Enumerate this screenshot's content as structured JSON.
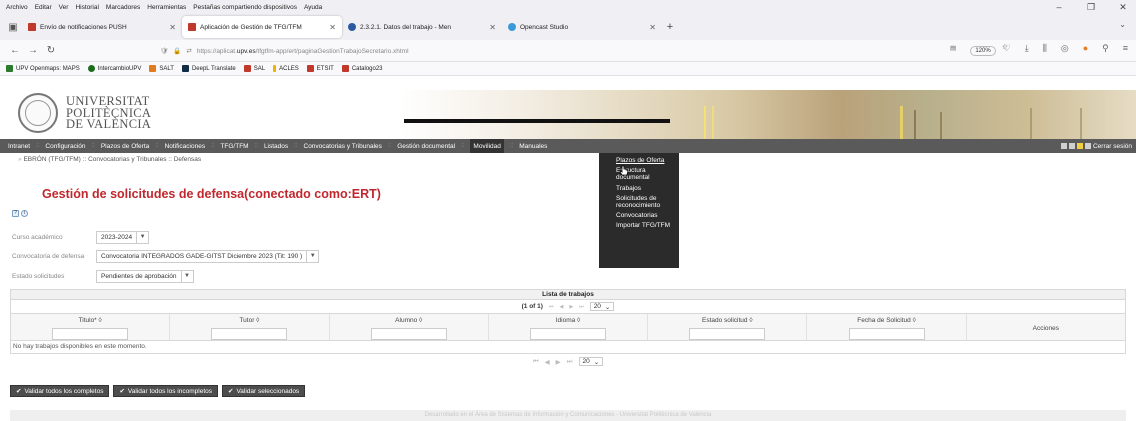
{
  "browser": {
    "menu": [
      "Archivo",
      "Editar",
      "Ver",
      "Historial",
      "Marcadores",
      "Herramientas",
      "Pestañas compartiendo dispositivos",
      "Ayuda"
    ],
    "tabs": [
      {
        "title": "Envío de notificaciones PUSH",
        "favicon_color": "#c0392b",
        "active": false
      },
      {
        "title": "Aplicación de Gestión de TFG/TFM",
        "favicon_color": "#c0392b",
        "active": true
      },
      {
        "title": "2.3.2.1. Datos del trabajo - Men",
        "favicon_color": "#2c5aa0",
        "active": false
      },
      {
        "title": "Opencast Studio",
        "favicon_color": "#3a9ad9",
        "active": false
      }
    ],
    "url_prefix": "https://aplicat.",
    "url_host": "upv.es",
    "url_path": "/tfgtfm-app/ert/paginaGestionTrabajoSecretario.xhtml",
    "zoom": "120%",
    "bookmarks": [
      {
        "label": "UPV Openmaps: MAPS",
        "color": "#2c7a2c"
      },
      {
        "label": "IntercambioUPV",
        "color": "#1a6d1a"
      },
      {
        "label": "SALT",
        "color": "#e27a20"
      },
      {
        "label": "DeepL Translate",
        "color": "#0f2b46"
      },
      {
        "label": "SAL",
        "color": "#c0392b"
      },
      {
        "label": "ACLES",
        "color": "#f0b400"
      },
      {
        "label": "ETSIT",
        "color": "#c0392b"
      },
      {
        "label": "Catalogo23",
        "color": "#c0392b"
      }
    ]
  },
  "header": {
    "logo_line1": "UNIVERSITAT",
    "logo_line2": "POLITÈCNICA",
    "logo_line3": "DE VALÈNCIA"
  },
  "nav": {
    "items": [
      "Intranet",
      "Configuración",
      "Plazos de Oferta",
      "Notificaciones",
      "TFG/TFM",
      "Listados",
      "Convocatorias y Tribunales",
      "Gestión documental",
      "Movilidad",
      "Manuales"
    ],
    "logout": "Cerrar sesión"
  },
  "breadcrumb": "EBRÓN (TFG/TFM) :: Convocatorias y Tribunales :: Defensas",
  "dropdown": {
    "options": [
      "Plazos de Oferta",
      "Estructura documental",
      "Trabajos",
      "Solicitudes de reconocimiento",
      "Convocatorias",
      "Importar TFG/TFM"
    ]
  },
  "page": {
    "title": "Gestión de solicitudes de defensa(conectado como:ERT)",
    "curso_label": "Curso académico",
    "curso_value": "2023-2024",
    "convocatoria_label": "Convocatoria de defensa",
    "convocatoria_value": "Convocatoria INTEGRADOS GADE-GITST Diciembre 2023 (Tit: 190 )",
    "estado_label": "Estado solicitudes",
    "estado_value": "Pendientes de aprobación"
  },
  "table": {
    "title": "Lista de trabajos",
    "page_indicator": "(1 of 1)",
    "per_page": "20",
    "columns": [
      "Titulo* ◊",
      "Tutor ◊",
      "Alumno ◊",
      "Idioma ◊",
      "Estado solicitud ◊",
      "Fecha de Solicitud ◊",
      "Acciones"
    ],
    "empty_message": "No hay trabajos disponibles en este momento."
  },
  "actions": {
    "validate_complete": "Validar todos los completos",
    "validate_incomplete": "Validar todos los incompletos",
    "validate_selected": "Validar seleccionados"
  },
  "footer": "Desarrollado en el Área de Sistemas de Información y Comunicaciones - Universitat Politècnica de València"
}
